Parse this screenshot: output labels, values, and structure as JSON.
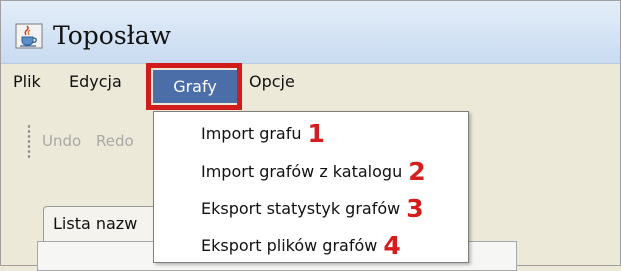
{
  "window": {
    "title": "Toposław",
    "icon": "java-cup-icon"
  },
  "menubar": {
    "items": [
      {
        "label": "Plik"
      },
      {
        "label": "Edycja"
      },
      {
        "label": "Grafy",
        "active": true
      },
      {
        "label": "Opcje"
      }
    ],
    "highlight_color": "#d21b1b",
    "active_bg": "#4b6ea9"
  },
  "toolbar": {
    "undo_label": "Undo",
    "redo_label": "Redo"
  },
  "tabs": [
    {
      "label": "Lista nazw"
    }
  ],
  "dropdown": {
    "items": [
      {
        "label": "Import grafu",
        "badge": "1"
      },
      {
        "label": "Import grafów z katalogu",
        "badge": "2"
      },
      {
        "label": "Eksport statystyk grafów",
        "badge": "3"
      },
      {
        "label": "Eksport plików grafów",
        "badge": "4"
      }
    ],
    "badge_color": "#d61c1c"
  }
}
